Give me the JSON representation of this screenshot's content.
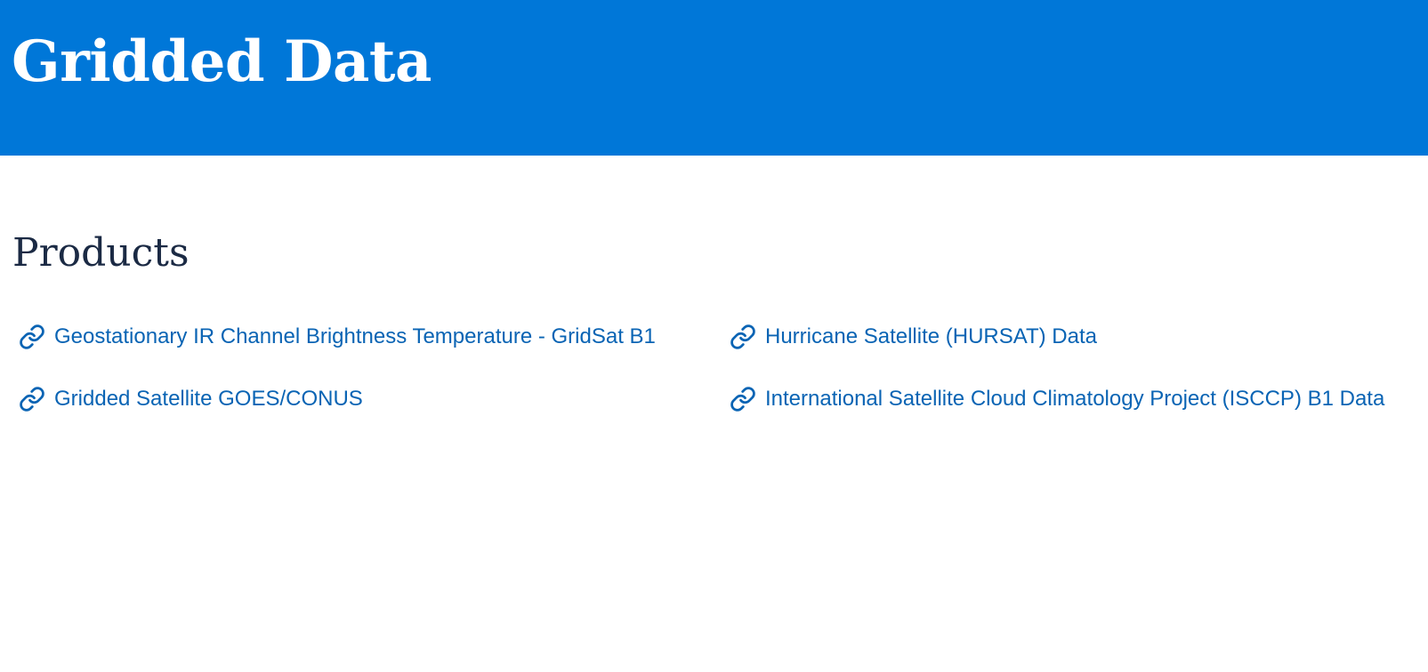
{
  "header": {
    "title": "Gridded Data",
    "background_color": "#0077d8"
  },
  "products": {
    "heading": "Products",
    "link_color": "#0a64b4",
    "items": [
      {
        "label": "Geostationary IR Channel Brightness Temperature - GridSat B1",
        "icon": "link-icon"
      },
      {
        "label": "Gridded Satellite GOES/CONUS",
        "icon": "link-icon"
      },
      {
        "label": "Hurricane Satellite (HURSAT) Data",
        "icon": "link-icon"
      },
      {
        "label": "International Satellite Cloud Climatology Project (ISCCP) B1 Data",
        "icon": "link-icon"
      }
    ]
  }
}
